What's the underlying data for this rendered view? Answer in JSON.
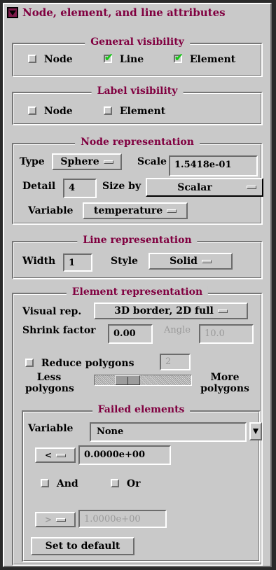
{
  "header": {
    "title": "Node, element, and line attributes"
  },
  "general_visibility": {
    "title": "General visibility",
    "node": {
      "label": "Node",
      "checked": false
    },
    "line": {
      "label": "Line",
      "checked": true
    },
    "element": {
      "label": "Element",
      "checked": true
    }
  },
  "label_visibility": {
    "title": "Label visibility",
    "node": {
      "label": "Node",
      "checked": false
    },
    "element": {
      "label": "Element",
      "checked": false
    }
  },
  "node_representation": {
    "title": "Node representation",
    "type_label": "Type",
    "type_value": "Sphere",
    "scale_label": "Scale",
    "scale_value": "1.5418e-01",
    "detail_label": "Detail",
    "detail_value": "4",
    "size_by_label": "Size by",
    "size_by_value": "Scalar",
    "variable_label": "Variable",
    "variable_value": "temperature"
  },
  "line_representation": {
    "title": "Line representation",
    "width_label": "Width",
    "width_value": "1",
    "style_label": "Style",
    "style_value": "Solid"
  },
  "element_representation": {
    "title": "Element representation",
    "visual_rep_label": "Visual rep.",
    "visual_rep_value": "3D border, 2D full",
    "shrink_label": "Shrink factor",
    "shrink_value": "0.00",
    "angle_label": "Angle",
    "angle_value": "10.0",
    "reduce_label": "Reduce polygons",
    "reduce_checked": false,
    "reduce_value": "2",
    "less_label_1": "Less",
    "less_label_2": "polygons",
    "more_label_1": "More",
    "more_label_2": "polygons",
    "slider_fraction": 0.28
  },
  "failed_elements": {
    "title": "Failed elements",
    "variable_label": "Variable",
    "variable_value": "None",
    "op1": "<",
    "value1": "0.0000e+00",
    "and_label": "And",
    "or_label": "Or",
    "op2": ">",
    "value2": "1.0000e+00",
    "default_button": "Set to default"
  }
}
